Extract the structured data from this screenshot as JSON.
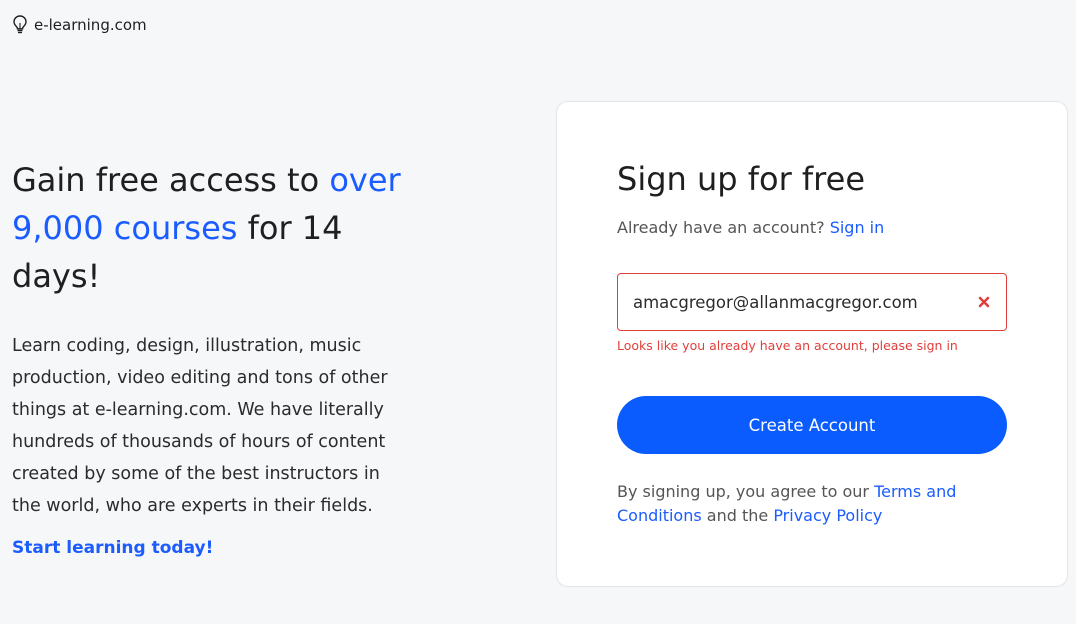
{
  "header": {
    "logo_icon": "lightbulb-icon",
    "site_name": "e-learning.com"
  },
  "hero": {
    "title_part1": "Gain free access to ",
    "title_highlight": "over 9,000 courses",
    "title_part2": " for 14 days!",
    "description": "Learn coding, design, illustration, music production, video editing and tons of other things at e-learning.com. We have literally hundreds of thousands of hours of content created by some of the best instructors in the world, who are experts in their fields.",
    "cta_link": "Start learning today!"
  },
  "signup": {
    "title": "Sign up for free",
    "already_text": "Already have an account?",
    "signin_link": "Sign in",
    "email_value": "amacgregor@allanmacgregor.com",
    "clear_icon": "close-icon",
    "error_message": "Looks like you already have an account, please sign in",
    "create_button": "Create Account",
    "terms_prefix": "By signing up, you agree to our ",
    "terms_link": "Terms and Conditions",
    "terms_middle": " and the ",
    "privacy_link": "Privacy Policy"
  },
  "colors": {
    "accent": "#1a5cff",
    "button": "#0a5cff",
    "error": "#e0403c",
    "background": "#f6f7f9"
  }
}
